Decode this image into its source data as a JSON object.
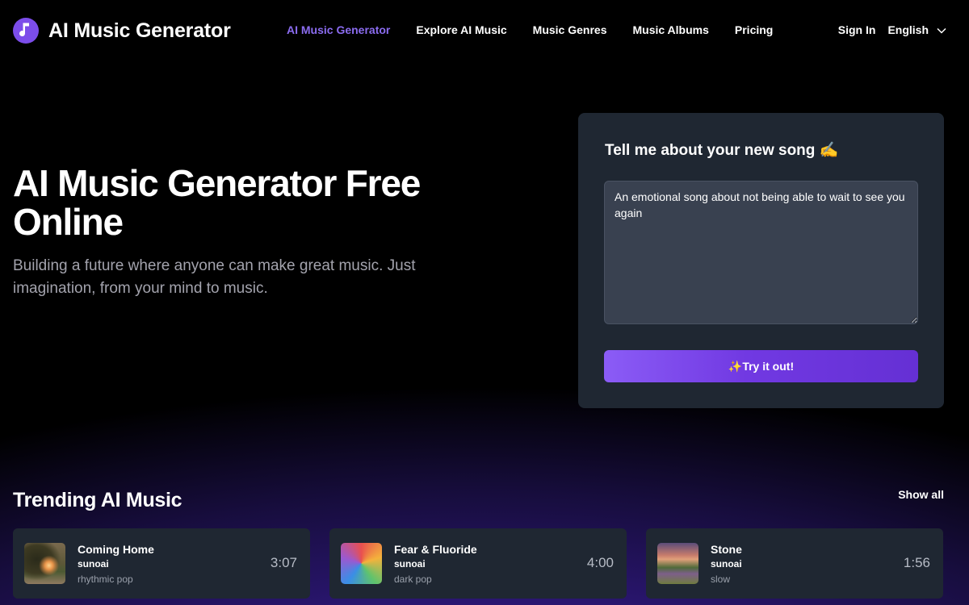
{
  "header": {
    "brand": "AI Music Generator",
    "nav": [
      {
        "label": "AI Music Generator",
        "active": true
      },
      {
        "label": "Explore AI Music",
        "active": false
      },
      {
        "label": "Music Genres",
        "active": false
      },
      {
        "label": "Music Albums",
        "active": false
      },
      {
        "label": "Pricing",
        "active": false
      }
    ],
    "sign_in": "Sign In",
    "language": "English"
  },
  "hero": {
    "title": "AI Music Generator Free Online",
    "subtitle": "Building a future where anyone can make great music. Just imagination, from your mind to music."
  },
  "prompt_card": {
    "title": "Tell me about your new song",
    "title_emoji": "✍️",
    "textarea_value": "An emotional song about not being able to wait to see you again",
    "button_emoji": "✨",
    "button_label": "Try it out!"
  },
  "trending": {
    "title": "Trending AI Music",
    "show_all": "Show all",
    "tracks": [
      {
        "title": "Coming Home",
        "artist": "sunoai",
        "genre": "rhythmic pop",
        "duration": "3:07"
      },
      {
        "title": "Fear & Fluoride",
        "artist": "sunoai",
        "genre": "dark pop",
        "duration": "4:00"
      },
      {
        "title": "Stone",
        "artist": "sunoai",
        "genre": "slow",
        "duration": "1:56"
      }
    ]
  },
  "colors": {
    "accent": "#8b6cf0",
    "logo_bg": "#7c4dea",
    "card_bg": "#1f2732",
    "button_gradient_start": "#8b5cf6",
    "button_gradient_end": "#6530d4"
  }
}
